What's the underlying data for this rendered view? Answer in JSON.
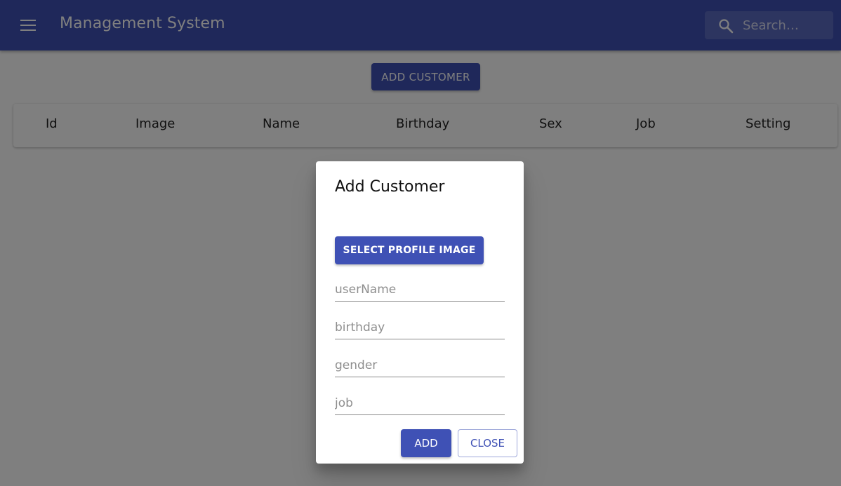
{
  "colors": {
    "primary": "#3f51b5",
    "backdrop": "rgba(0,0,0,0.5)"
  },
  "appbar": {
    "menu_icon": "menu-icon",
    "title": "Management System",
    "search": {
      "icon": "search-icon",
      "placeholder": "Search…",
      "value": ""
    }
  },
  "main": {
    "add_customer_label": "ADD CUSTOMER",
    "table": {
      "columns": [
        "Id",
        "Image",
        "Name",
        "Birthday",
        "Sex",
        "Job",
        "Setting"
      ]
    }
  },
  "dialog": {
    "title": "Add Customer",
    "select_image_label": "SELECT PROFILE IMAGE",
    "fields": [
      {
        "placeholder": "userName",
        "value": ""
      },
      {
        "placeholder": "birthday",
        "value": ""
      },
      {
        "placeholder": "gender",
        "value": ""
      },
      {
        "placeholder": "job",
        "value": ""
      }
    ],
    "add_label": "ADD",
    "close_label": "CLOSE"
  }
}
